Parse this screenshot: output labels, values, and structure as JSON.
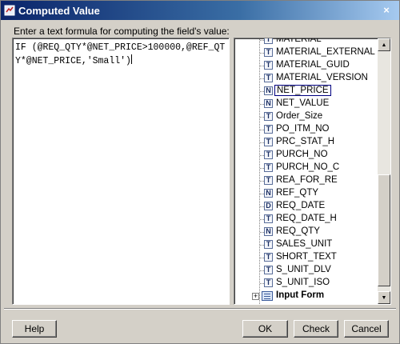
{
  "window": {
    "title": "Computed Value",
    "close_glyph": "×"
  },
  "prompt": "Enter a text formula for computing the field's value:",
  "formula": {
    "value": "IF (@REQ_QTY*@NET_PRICE>100000,@REF_QTY*@NET_PRICE,'Small')"
  },
  "fields": [
    {
      "type": "T",
      "name": "MATERIAL",
      "selected": false
    },
    {
      "type": "T",
      "name": "MATERIAL_EXTERNAL",
      "selected": false
    },
    {
      "type": "T",
      "name": "MATERIAL_GUID",
      "selected": false
    },
    {
      "type": "T",
      "name": "MATERIAL_VERSION",
      "selected": false
    },
    {
      "type": "N",
      "name": "NET_PRICE",
      "selected": true
    },
    {
      "type": "N",
      "name": "NET_VALUE",
      "selected": false
    },
    {
      "type": "T",
      "name": "Order_Size",
      "selected": false
    },
    {
      "type": "T",
      "name": "PO_ITM_NO",
      "selected": false
    },
    {
      "type": "T",
      "name": "PRC_STAT_H",
      "selected": false
    },
    {
      "type": "T",
      "name": "PURCH_NO",
      "selected": false
    },
    {
      "type": "T",
      "name": "PURCH_NO_C",
      "selected": false
    },
    {
      "type": "T",
      "name": "REA_FOR_RE",
      "selected": false
    },
    {
      "type": "N",
      "name": "REF_QTY",
      "selected": false
    },
    {
      "type": "D",
      "name": "REQ_DATE",
      "selected": false
    },
    {
      "type": "T",
      "name": "REQ_DATE_H",
      "selected": false
    },
    {
      "type": "N",
      "name": "REQ_QTY",
      "selected": false
    },
    {
      "type": "T",
      "name": "SALES_UNIT",
      "selected": false
    },
    {
      "type": "T",
      "name": "SHORT_TEXT",
      "selected": false
    },
    {
      "type": "T",
      "name": "S_UNIT_DLV",
      "selected": false
    },
    {
      "type": "T",
      "name": "S_UNIT_ISO",
      "selected": false
    }
  ],
  "tree_node": {
    "label": "Input Form",
    "expander": "+",
    "icon": "form-icon"
  },
  "scrollbar": {
    "up_glyph": "▲",
    "down_glyph": "▼"
  },
  "buttons": {
    "help": "Help",
    "ok": "OK",
    "check": "Check",
    "cancel": "Cancel"
  },
  "colors": {
    "title_bar": "#0a246a",
    "selection_border": "#000080",
    "dialog_bg": "#d4d0c8"
  }
}
